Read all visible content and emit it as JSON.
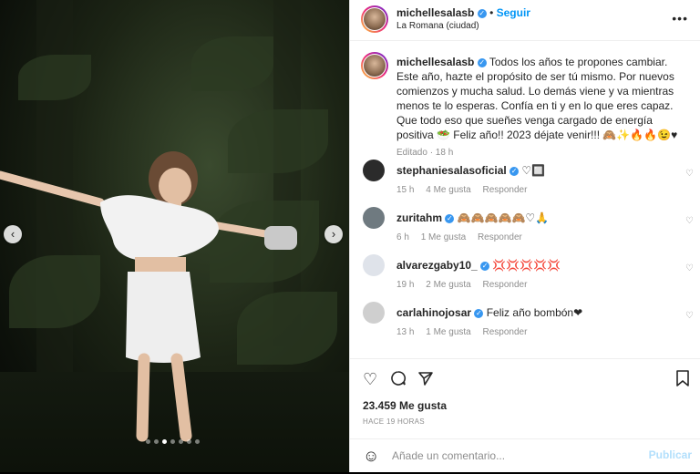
{
  "post": {
    "username": "michellesalasb",
    "follow_label": "Seguir",
    "location": "La Romana (ciudad)",
    "more_label": "•••",
    "caption_text": "Todos los años te propones cambiar. Este año, hazte el propósito de ser tú mismo. Por nuevos comienzos y mucha salud. Lo demás viene y va mientras menos te lo esperas. Confía en ti y en lo que eres capaz. Que todo eso que sueñes venga cargado de energía positiva 🥗 Feliz año!! 2023 déjate venir!!! 🙈✨🔥🔥😉♥",
    "caption_meta": "Editado · 18 h",
    "likes": "23.459 Me gusta",
    "posted_time": "HACE 19 HORAS",
    "add_comment_placeholder": "Añade un comentario...",
    "publish_label": "Publicar"
  },
  "comments": [
    {
      "username": "stephaniesalasoficial",
      "text": "♡🔲",
      "time": "15 h",
      "likes": "4 Me gusta",
      "reply": "Responder",
      "avatar_color": "#2b2b2b"
    },
    {
      "username": "zuritahm",
      "text": "🙈🙈🙈🙈🙈♡🙏",
      "time": "6 h",
      "likes": "1 Me gusta",
      "reply": "Responder",
      "avatar_color": "#6f7a80"
    },
    {
      "username": "alvarezgaby10_",
      "text": "💢💢💢💢💢",
      "time": "19 h",
      "likes": "2 Me gusta",
      "reply": "Responder",
      "avatar_color": "#dfe3ea"
    },
    {
      "username": "carlahinojosar",
      "text": "Feliz año bombón❤",
      "time": "13 h",
      "likes": "1 Me gusta",
      "reply": "Responder",
      "avatar_color": "#cfcfcf"
    }
  ],
  "icons": {
    "heart": "♡",
    "comment": "○",
    "share": "➤",
    "save": "🔖",
    "emoji": "☺",
    "prev": "‹",
    "next": "›"
  },
  "colors": {
    "accent": "#0095f6",
    "verified": "#3897f0",
    "publish_disabled": "#b2dffc"
  },
  "carousel": {
    "count": 7,
    "active_index": 2
  }
}
